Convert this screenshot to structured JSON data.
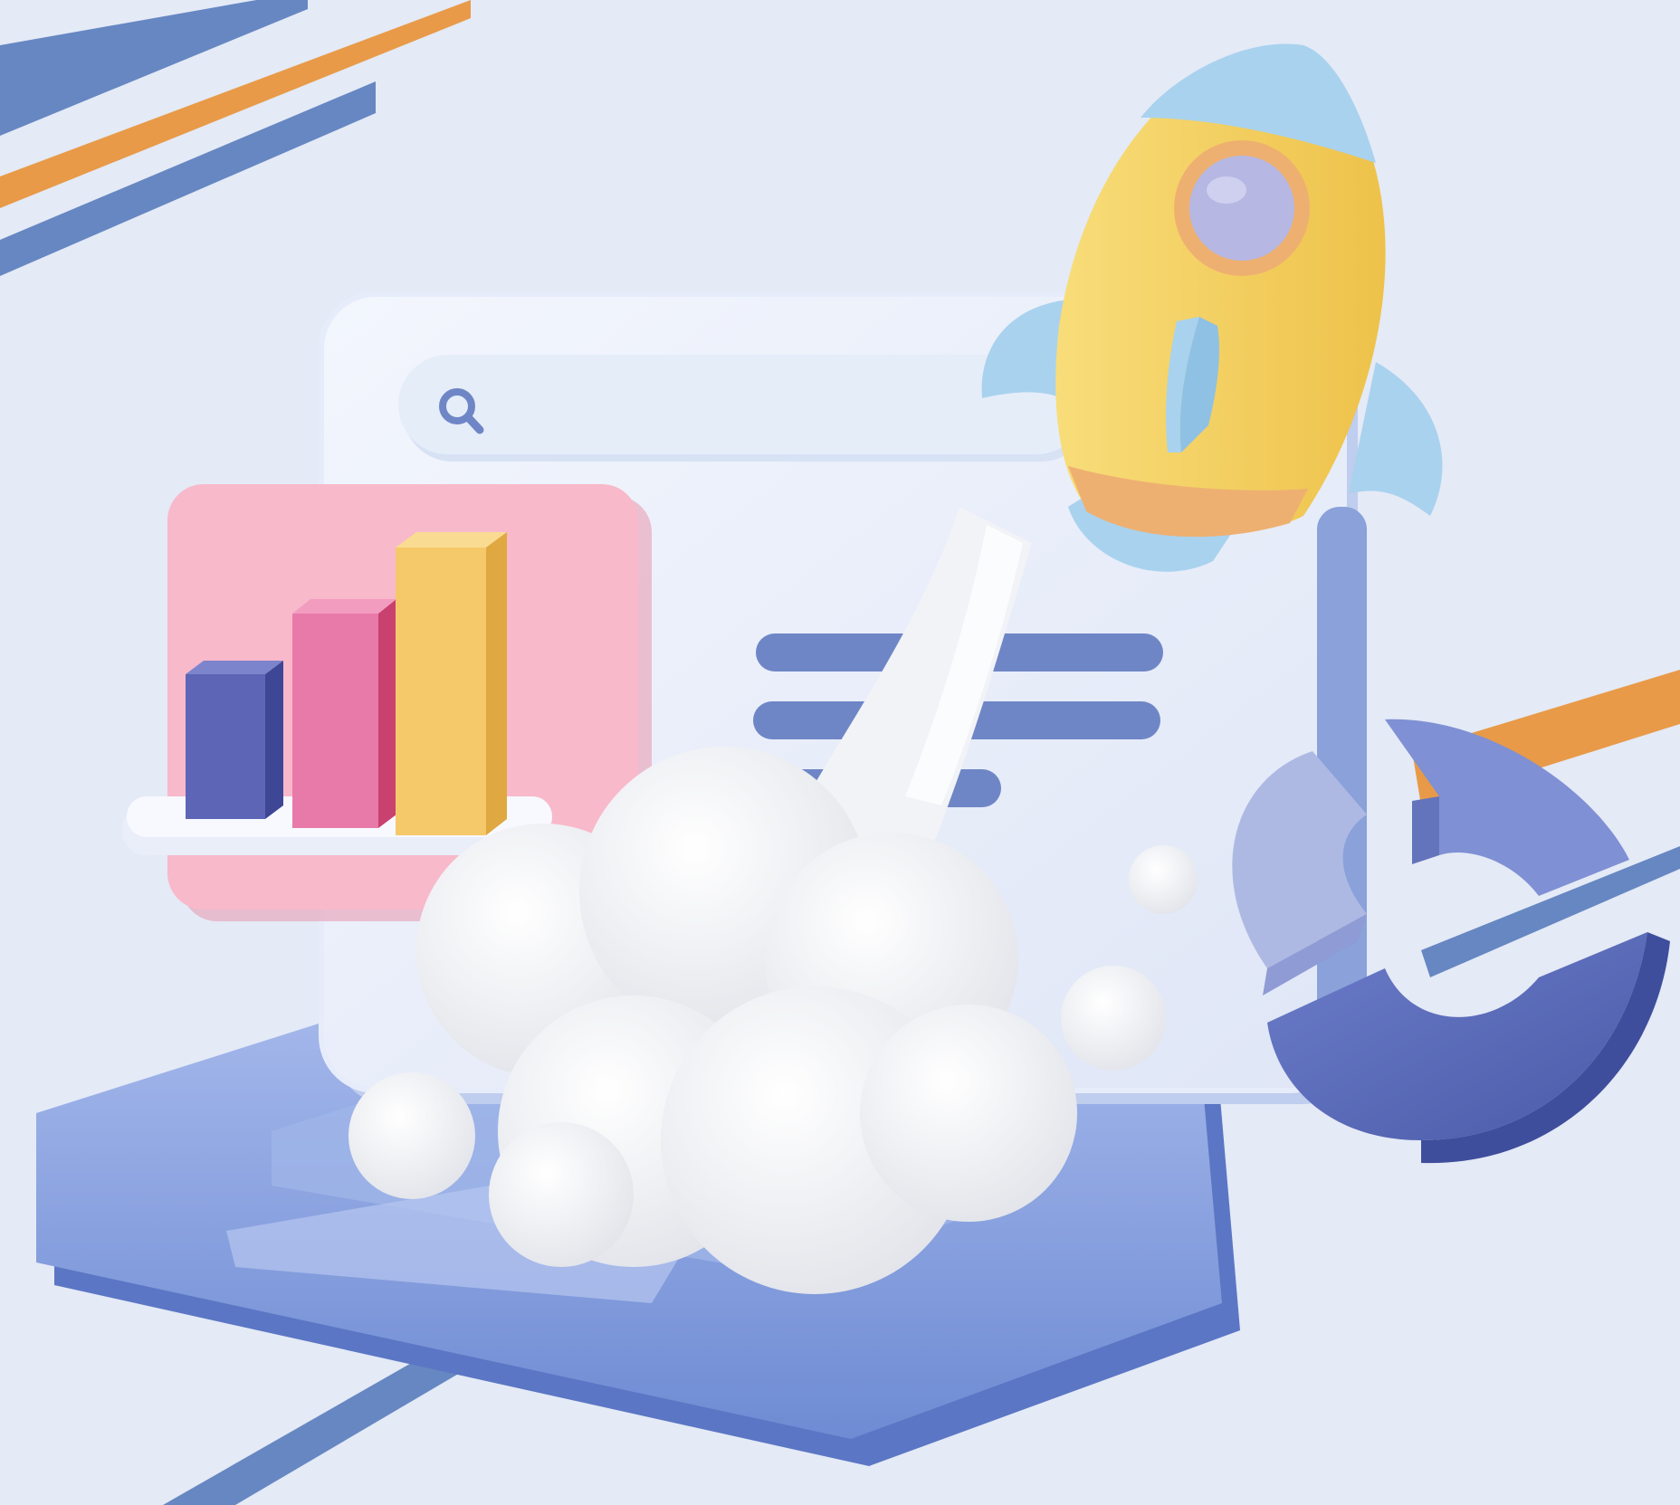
{
  "illustration": {
    "theme": "business growth / startup launch",
    "elements": [
      "monitor-window",
      "search-bar",
      "bar-chart-card",
      "rocket",
      "smoke-cloud",
      "pie-chart",
      "keyboard-base"
    ],
    "colors": {
      "background": "#e4eaf6",
      "stripe_blue": "#6687c2",
      "stripe_orange": "#e89a48",
      "rocket_body": "#f5d15a",
      "rocket_wing": "#a9d2ee",
      "rocket_window": "#b6b7e2",
      "bar_blue": "#5d66b6",
      "bar_pink": "#e5609a",
      "bar_yellow": "#f5c96a",
      "card_pink": "#f8b9cb",
      "pie_dark": "#5c6fbd",
      "pie_mid": "#7f90d4",
      "pie_light": "#aeb9e3",
      "keyboard": "#7f9ad8"
    }
  },
  "search": {
    "icon": "search-icon",
    "placeholder": ""
  },
  "bar_chart_card": {
    "icon": "bar-chart-icon",
    "bars_relative_height": [
      0.48,
      0.78,
      1.0
    ]
  },
  "pie_chart": {
    "icon": "pie-chart-icon",
    "segments": 3
  }
}
